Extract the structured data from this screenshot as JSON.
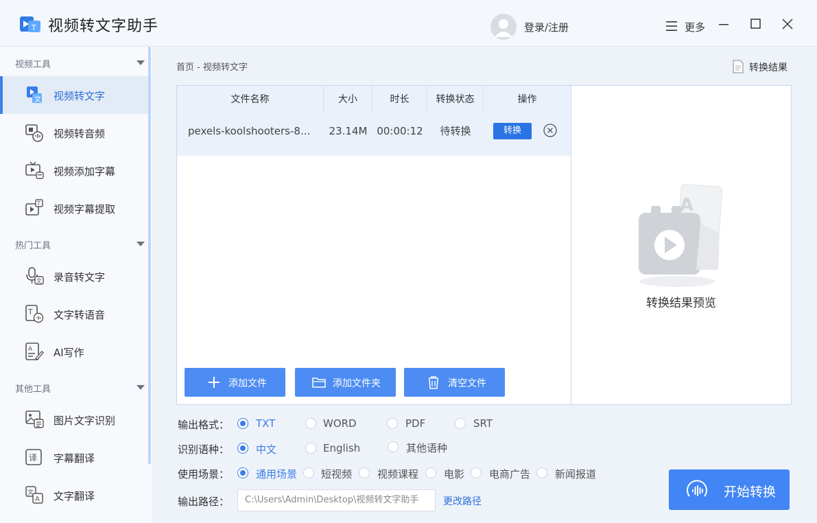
{
  "app": {
    "title": "视频转文字助手"
  },
  "header": {
    "login": "登录/注册",
    "more": "更多"
  },
  "sidebar": {
    "groups": [
      {
        "label": "视频工具",
        "items": [
          {
            "label": "视频转文字",
            "icon": "video-to-text-icon",
            "active": true
          },
          {
            "label": "视频转音频",
            "icon": "video-to-audio-icon"
          },
          {
            "label": "视频添加字幕",
            "icon": "add-subtitle-icon"
          },
          {
            "label": "视频字幕提取",
            "icon": "extract-subtitle-icon"
          }
        ]
      },
      {
        "label": "热门工具",
        "items": [
          {
            "label": "录音转文字",
            "icon": "mic-icon"
          },
          {
            "label": "文字转语音",
            "icon": "text-to-speech-icon"
          },
          {
            "label": "AI写作",
            "icon": "ai-writing-icon"
          }
        ]
      },
      {
        "label": "其他工具",
        "items": [
          {
            "label": "图片文字识别",
            "icon": "image-ocr-icon"
          },
          {
            "label": "字幕翻译",
            "icon": "subtitle-translate-icon"
          },
          {
            "label": "文字翻译",
            "icon": "text-translate-icon"
          }
        ]
      }
    ]
  },
  "breadcrumb": "首页 - 视频转文字",
  "result_link": "转换结果",
  "table": {
    "headers": [
      "文件名称",
      "大小",
      "时长",
      "转换状态",
      "操作"
    ],
    "rows": [
      {
        "name": "pexels-koolshooters-8...",
        "size": "23.14M",
        "duration": "00:00:12",
        "status": "待转换",
        "action": "转换"
      }
    ]
  },
  "actions": {
    "add_file": "添加文件",
    "add_folder": "添加文件夹",
    "clear": "清空文件"
  },
  "preview": {
    "label": "转换结果预览"
  },
  "options": {
    "format": {
      "key": "输出格式：",
      "choices": [
        "TXT",
        "WORD",
        "PDF",
        "SRT"
      ],
      "selected": "TXT"
    },
    "language": {
      "key": "识别语种：",
      "choices": [
        "中文",
        "English",
        "其他语种"
      ],
      "selected": "中文"
    },
    "scene": {
      "key": "使用场景：",
      "choices": [
        "通用场景",
        "短视频",
        "视频课程",
        "电影",
        "电商广告",
        "新闻报道"
      ],
      "selected": "通用场景"
    },
    "path": {
      "key": "输出路径：",
      "value": "C:\\Users\\Admin\\Desktop\\视频转文字助手",
      "change": "更改路径"
    }
  },
  "start_button": "开始转换",
  "colors": {
    "accent": "#4285f4",
    "active_text": "#2d6fd8",
    "sidebar_active_bg": "#e3ebf7"
  }
}
